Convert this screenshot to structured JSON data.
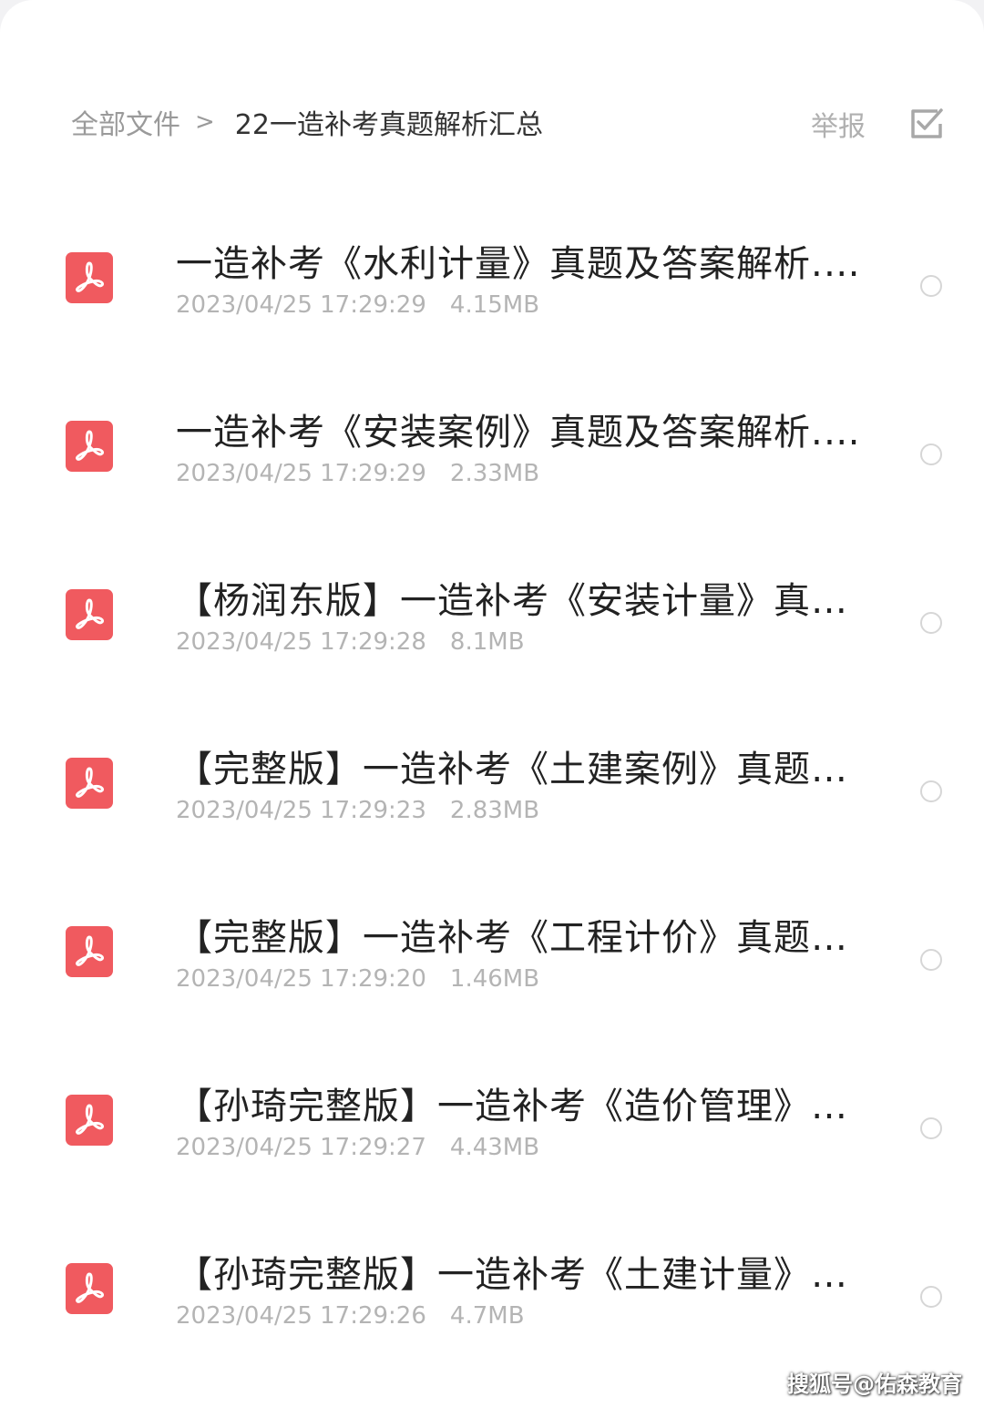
{
  "breadcrumb": {
    "root": "全部文件",
    "separator": ">",
    "current": "22一造补考真题解析汇总"
  },
  "header": {
    "report_label": "举报",
    "select_icon": "checkbox-select-icon"
  },
  "files": [
    {
      "name": "一造补考《水利计量》真题及答案解析.pdf",
      "date": "2023/04/25 17:29:29",
      "size": "4.15MB",
      "icon": "pdf-icon"
    },
    {
      "name": "一造补考《安装案例》真题及答案解析.pdf",
      "date": "2023/04/25 17:29:29",
      "size": "2.33MB",
      "icon": "pdf-icon"
    },
    {
      "name": "【杨润东版】一造补考《安装计量》真…",
      "date": "2023/04/25 17:29:28",
      "size": "8.1MB",
      "icon": "pdf-icon"
    },
    {
      "name": "【完整版】一造补考《土建案例》真题…",
      "date": "2023/04/25 17:29:23",
      "size": "2.83MB",
      "icon": "pdf-icon"
    },
    {
      "name": "【完整版】一造补考《工程计价》真题…",
      "date": "2023/04/25 17:29:20",
      "size": "1.46MB",
      "icon": "pdf-icon"
    },
    {
      "name": "【孙琦完整版】一造补考《造价管理》…",
      "date": "2023/04/25 17:29:27",
      "size": "4.43MB",
      "icon": "pdf-icon"
    },
    {
      "name": "【孙琦完整版】一造补考《土建计量》…",
      "date": "2023/04/25 17:29:26",
      "size": "4.7MB",
      "icon": "pdf-icon"
    }
  ],
  "colors": {
    "pdf_icon": "#f05a5f",
    "text_primary": "#222222",
    "text_secondary": "#b4b4b4"
  },
  "watermark": "搜狐号@佑森教育"
}
